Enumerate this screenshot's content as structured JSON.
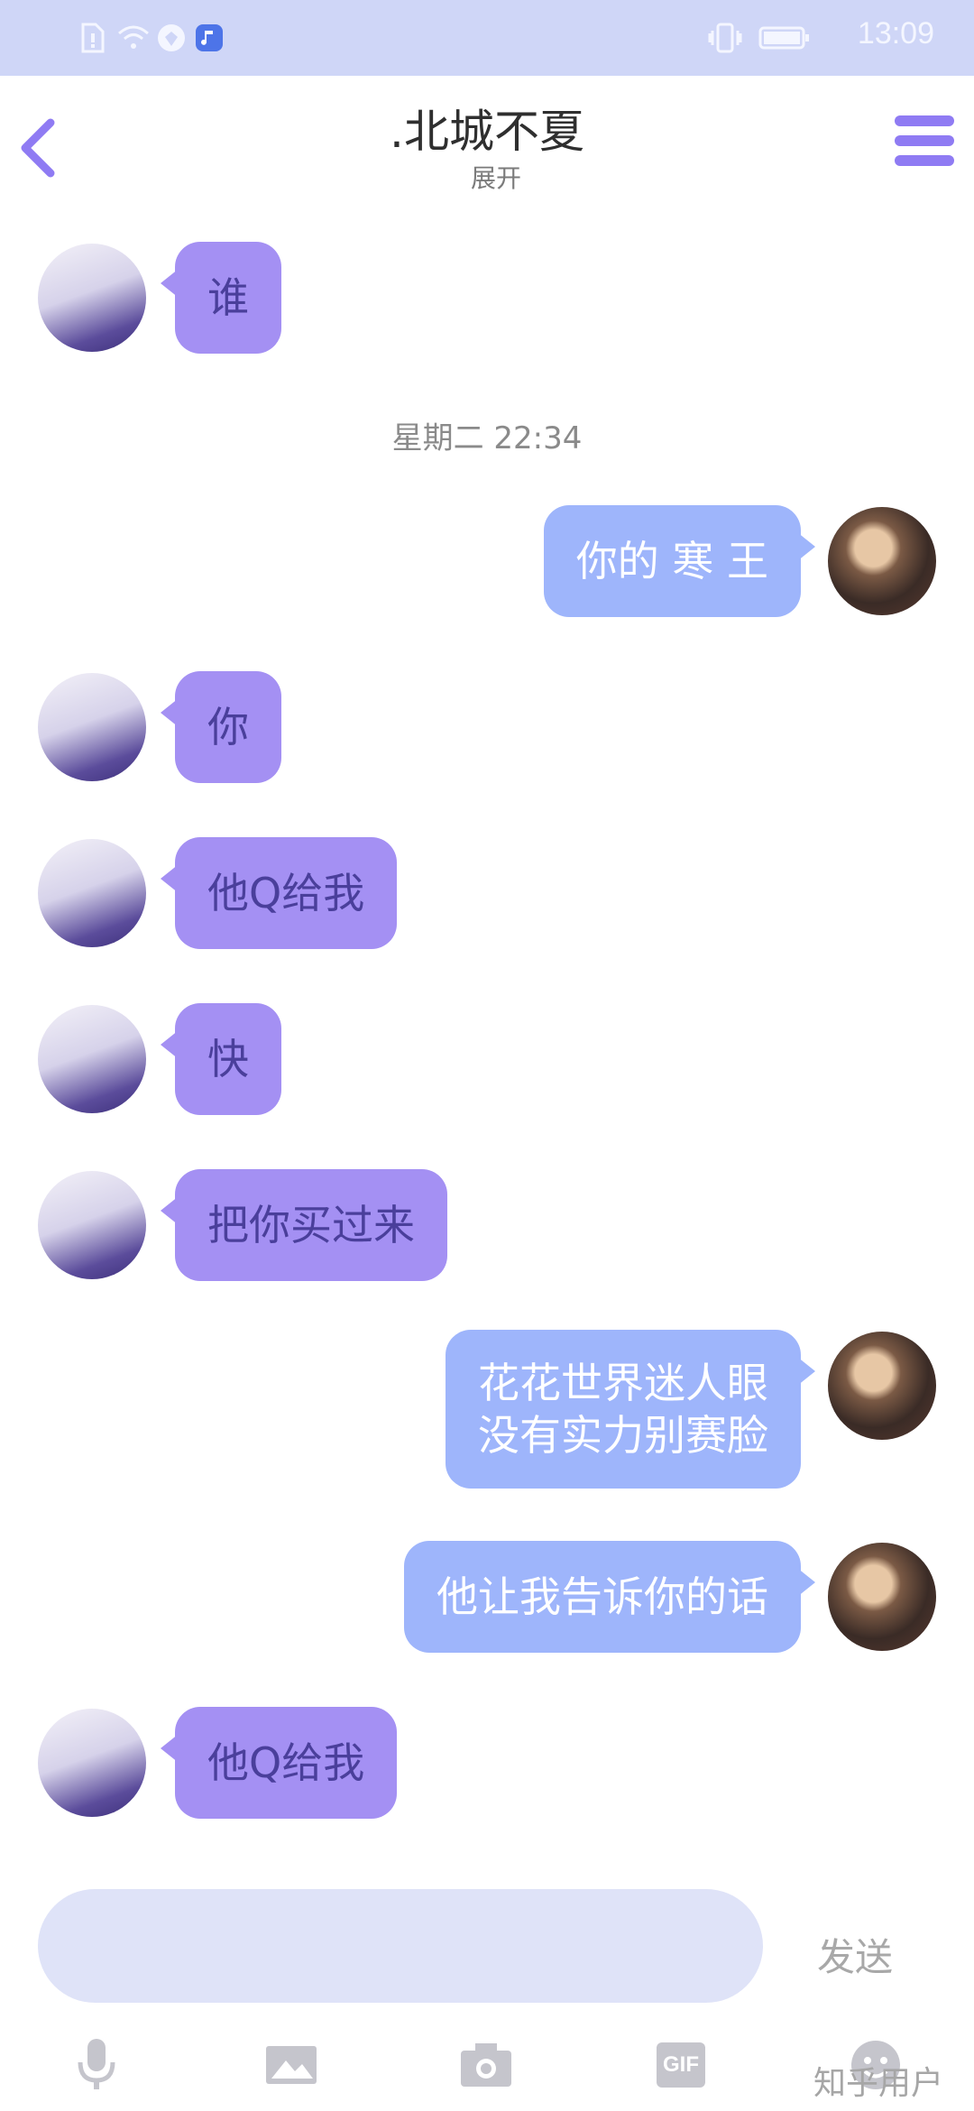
{
  "status_bar": {
    "time": "13:09"
  },
  "header": {
    "title": ".北城不夏",
    "subtitle": "展开"
  },
  "messages": [
    {
      "side": "left",
      "lines": [
        "谁"
      ]
    },
    {
      "side": "right",
      "lines": [
        "你的 寒 王"
      ]
    },
    {
      "side": "left",
      "lines": [
        "你"
      ]
    },
    {
      "side": "left",
      "lines": [
        "他Q给我"
      ]
    },
    {
      "side": "left",
      "lines": [
        "快"
      ]
    },
    {
      "side": "left",
      "lines": [
        "把你买过来"
      ]
    },
    {
      "side": "right",
      "lines": [
        "花花世界迷人眼",
        "没有实力别赛脸"
      ]
    },
    {
      "side": "right",
      "lines": [
        "他让我告诉你的话"
      ]
    },
    {
      "side": "left",
      "lines": [
        "他Q给我"
      ]
    }
  ],
  "timestamp": "星期二 22:34",
  "input": {
    "send_label": "发送"
  },
  "toolbar": {
    "gif_label": "GIF"
  },
  "watermark": "知乎用户",
  "colors": {
    "status_bar": "#cfd6f7",
    "accent": "#8f7bf3",
    "bubble_left": "#a490f3",
    "bubble_right": "#9eb5fb",
    "input_bg": "#dfe3f8"
  }
}
